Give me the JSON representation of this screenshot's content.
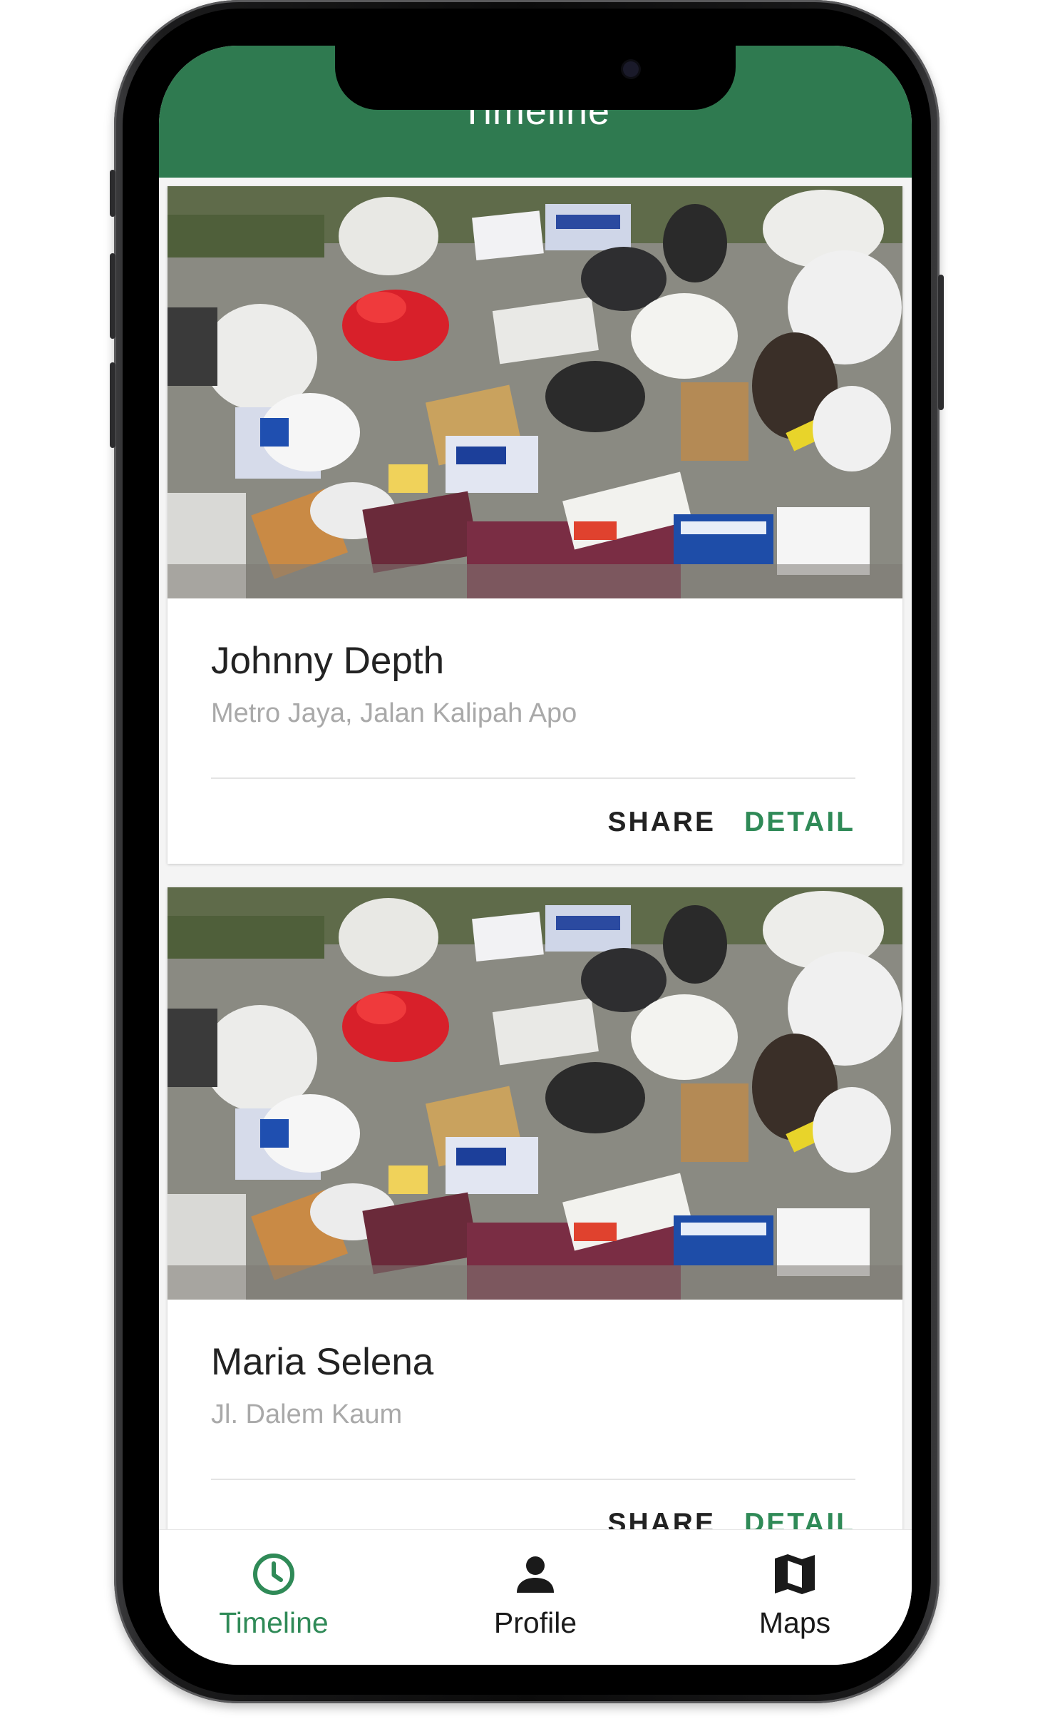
{
  "app": {
    "title": "Timeline",
    "accent_color": "#2f7a50"
  },
  "feed": {
    "posts": [
      {
        "name": "Johnny Depth",
        "location": "Metro Jaya, Jalan Kalipah Apo",
        "share_label": "SHARE",
        "detail_label": "DETAIL"
      },
      {
        "name": "Maria Selena",
        "location": "Jl. Dalem Kaum",
        "share_label": "SHARE",
        "detail_label": "DETAIL"
      }
    ]
  },
  "bottom_nav": {
    "items": [
      {
        "label": "Timeline",
        "icon": "clock-icon",
        "active": true
      },
      {
        "label": "Profile",
        "icon": "person-icon",
        "active": false
      },
      {
        "label": "Maps",
        "icon": "map-icon",
        "active": false
      }
    ],
    "active_color": "#2f8a57",
    "inactive_color": "#1a1a1a"
  }
}
